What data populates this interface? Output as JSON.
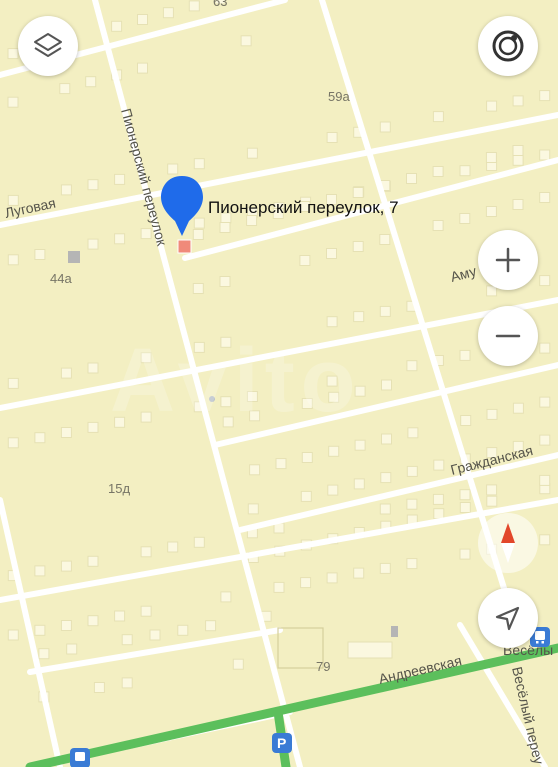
{
  "map": {
    "pin_label": "Пионерский переулок, 7",
    "streets": {
      "pionersky": "Пионерский переулок",
      "lugovaya": "Луговая",
      "amur": "Аму",
      "grazhdanskaya": "Гражданская",
      "andreevskaya": "Андреевская",
      "vesely_lane": "Весёлый переу",
      "vesely_stop": "Весёлы"
    },
    "house_numbers": {
      "n59a": "59а",
      "n44a": "44а",
      "n15d": "15д",
      "n79": "79",
      "n63": "63"
    },
    "parking_label": "P",
    "watermark": "Avito"
  },
  "colors": {
    "land": "#f3efc2",
    "road": "#ffffff",
    "main_road": "#5cbf5c",
    "building": "#fbf8e0",
    "pin": "#1f6bea",
    "marker_house": "#f08a7a",
    "compass_red": "#e2472a"
  },
  "icons": {
    "layers": "layers-icon",
    "compass_ring": "compass-ring-icon",
    "zoom_in": "plus-icon",
    "zoom_out": "minus-icon",
    "north": "north-arrow-icon",
    "locate": "location-arrow-icon",
    "bus": "bus-stop-icon",
    "parking": "parking-icon"
  }
}
